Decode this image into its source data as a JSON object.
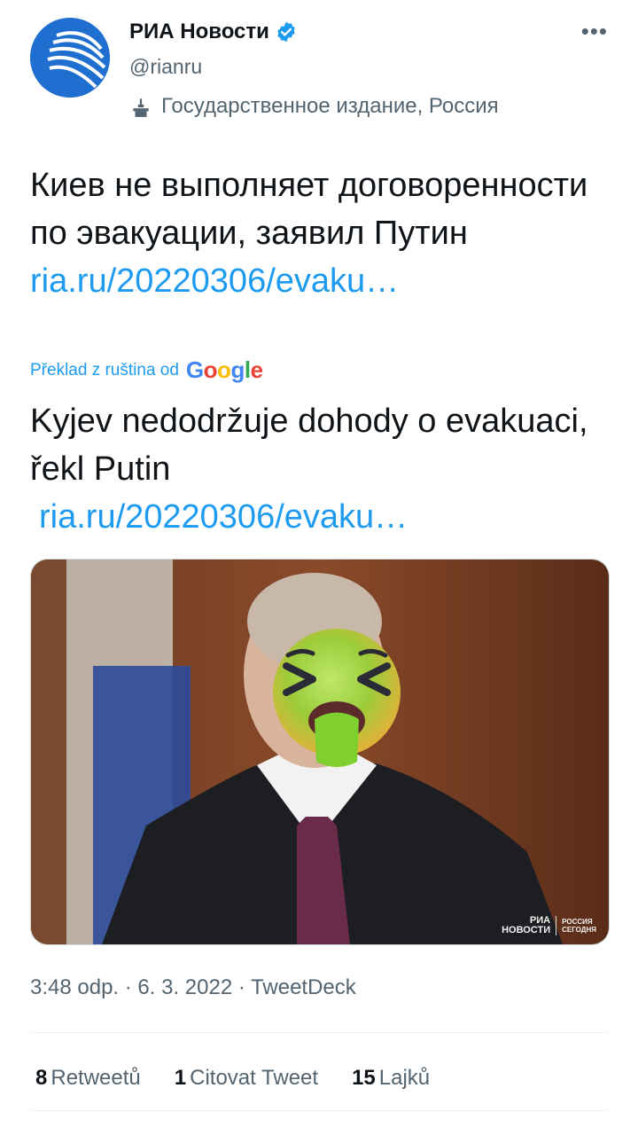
{
  "author": {
    "name": "РИА Новости",
    "handle": "@rianru",
    "affiliation": "Государственное издание, Россия"
  },
  "tweet": {
    "text": "Киев не выполняет договоренности по эвакуации, заявил Путин",
    "link": "ria.ru/20220306/evaku…",
    "translate_label": "Překlad z ruština od",
    "translate_provider": "Google",
    "translated_text": "Kyjev nedodržuje dohody o evakuaci, řekl Putin",
    "translated_link": "ria.ru/20220306/evaku…"
  },
  "media": {
    "watermark_line1": "РИА",
    "watermark_line2": "НОВОСТИ",
    "watermark_right1": "РОССИЯ",
    "watermark_right2": "СЕГОДНЯ"
  },
  "meta": {
    "timestamp": "3:48 odp. · 6. 3. 2022 · TweetDeck"
  },
  "stats": {
    "retweets_count": "8",
    "retweets_label": "Retweetů",
    "quotes_count": "1",
    "quotes_label": "Citovat Tweet",
    "likes_count": "15",
    "likes_label": "Lajků"
  },
  "colors": {
    "link": "#1d9bf0",
    "secondary_text": "#536471",
    "primary_text": "#0f1419",
    "avatar_blue": "#1f6fd1"
  },
  "icons": {
    "verified": "verified-badge-icon",
    "more": "more-options-icon",
    "affiliation": "government-podium-icon",
    "emoji": "nauseated-face-emoji"
  }
}
